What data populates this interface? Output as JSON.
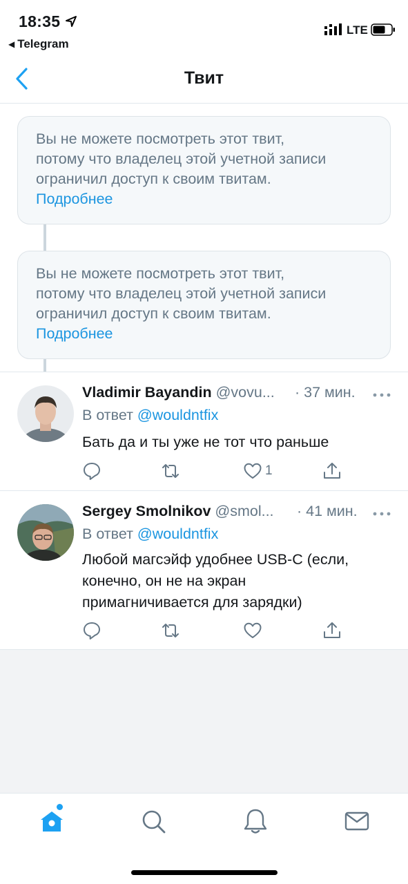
{
  "status_bar": {
    "time": "18:35",
    "back_app": "Telegram",
    "network": "LTE",
    "icons": [
      "location-arrow-icon",
      "signal-icon",
      "battery-icon"
    ]
  },
  "nav": {
    "title": "Твит",
    "back_icon": "chevron-left-icon"
  },
  "notices": [
    {
      "line1": "Вы не можете посмотреть этот твит,",
      "line2": "потому что владелец этой учетной записи",
      "line3": "ограничил доступ к своим твитам.",
      "more": "Подробнее"
    },
    {
      "line1": "Вы не можете посмотреть этот твит,",
      "line2": "потому что владелец этой учетной записи",
      "line3": "ограничил доступ к своим твитам.",
      "more": "Подробнее"
    }
  ],
  "tweets": [
    {
      "name": "Vladimir Bayandin",
      "handle": "@vovu...",
      "time": "· 37 мин.",
      "reply_prefix": "В ответ",
      "reply_to": "@wouldntfix",
      "text_lines": [
        "Бать да и ты уже не тот что раньше"
      ],
      "likes": "1"
    },
    {
      "name": "Sergey Smolnikov",
      "handle": "@smol...",
      "time": "· 41 мин.",
      "reply_prefix": "В ответ",
      "reply_to": "@wouldntfix",
      "text_lines": [
        "Любой магсэйф удобнее USB-C (если,",
        "конечно, он не на экран",
        "примагничивается для зарядки)"
      ],
      "likes": ""
    }
  ],
  "tab_bar": {
    "items": [
      "home-icon",
      "search-icon",
      "notifications-icon",
      "messages-icon"
    ],
    "accent": "#1da1f2"
  },
  "colors": {
    "link": "#1b95e0",
    "secondary_text": "#657786",
    "notice_bg": "#f5f8fa"
  }
}
